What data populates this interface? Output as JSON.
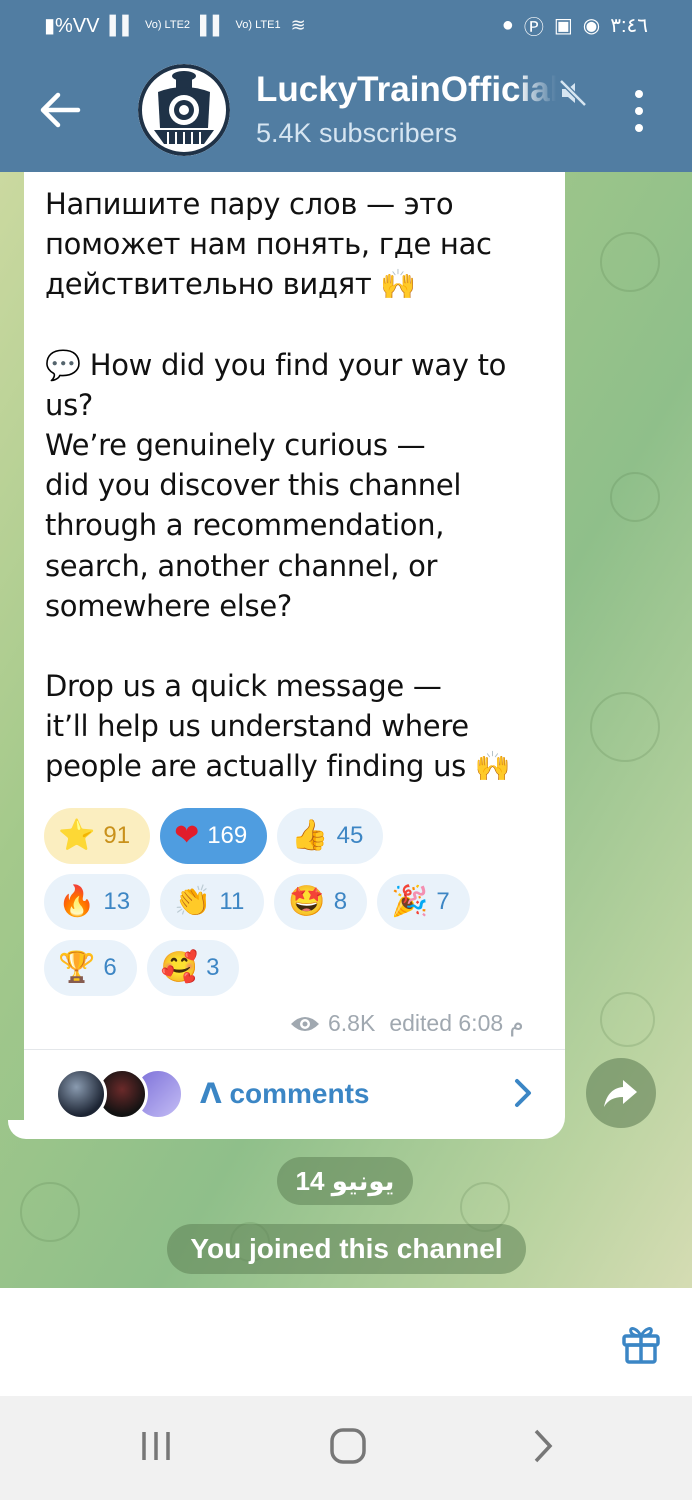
{
  "status_bar": {
    "left_text": "▮%VV",
    "network1": "Vo) LTE2",
    "network2": "Vo) LTE1",
    "time": "٣:٤٦"
  },
  "header": {
    "channel_name": "LuckyTrainOfficial",
    "subscribers": "5.4K subscribers",
    "back_icon": "arrow-left-icon",
    "mute_icon": "mute-speaker-icon",
    "menu_icon": "more-vertical-icon"
  },
  "message": {
    "paragraphs": [
      "Напишите пару слов — это\nпоможет нам понять, где нас\nдействительно видят 🙌",
      "💬 How did you find your way to\nus?\nWe’re genuinely curious —\ndid you discover this channel\nthrough a recommendation,\nsearch, another channel, or\nsomewhere else?",
      "Drop us a quick message —\nit’ll help us understand where\npeople are actually finding us 🙌"
    ],
    "reactions": [
      {
        "emoji": "⭐",
        "count": "91"
      },
      {
        "emoji": "❤",
        "count": "169"
      },
      {
        "emoji": "👍",
        "count": "45"
      },
      {
        "emoji": "🔥",
        "count": "13"
      },
      {
        "emoji": "👏",
        "count": "11"
      },
      {
        "emoji": "🤩",
        "count": "8"
      },
      {
        "emoji": "🎉",
        "count": "7"
      },
      {
        "emoji": "🏆",
        "count": "6"
      },
      {
        "emoji": "🥰",
        "count": "3"
      }
    ],
    "views": "6.8K",
    "edited_time": "edited 6:08 م",
    "comments_label": "ᐱ comments"
  },
  "date_separator": "14 يونيو",
  "service_message": "You joined this channel",
  "colors": {
    "header": "#517da2",
    "accent": "#3b86c5",
    "heart_reaction": "#4f9de0",
    "star_reaction": "#fbeec0"
  }
}
